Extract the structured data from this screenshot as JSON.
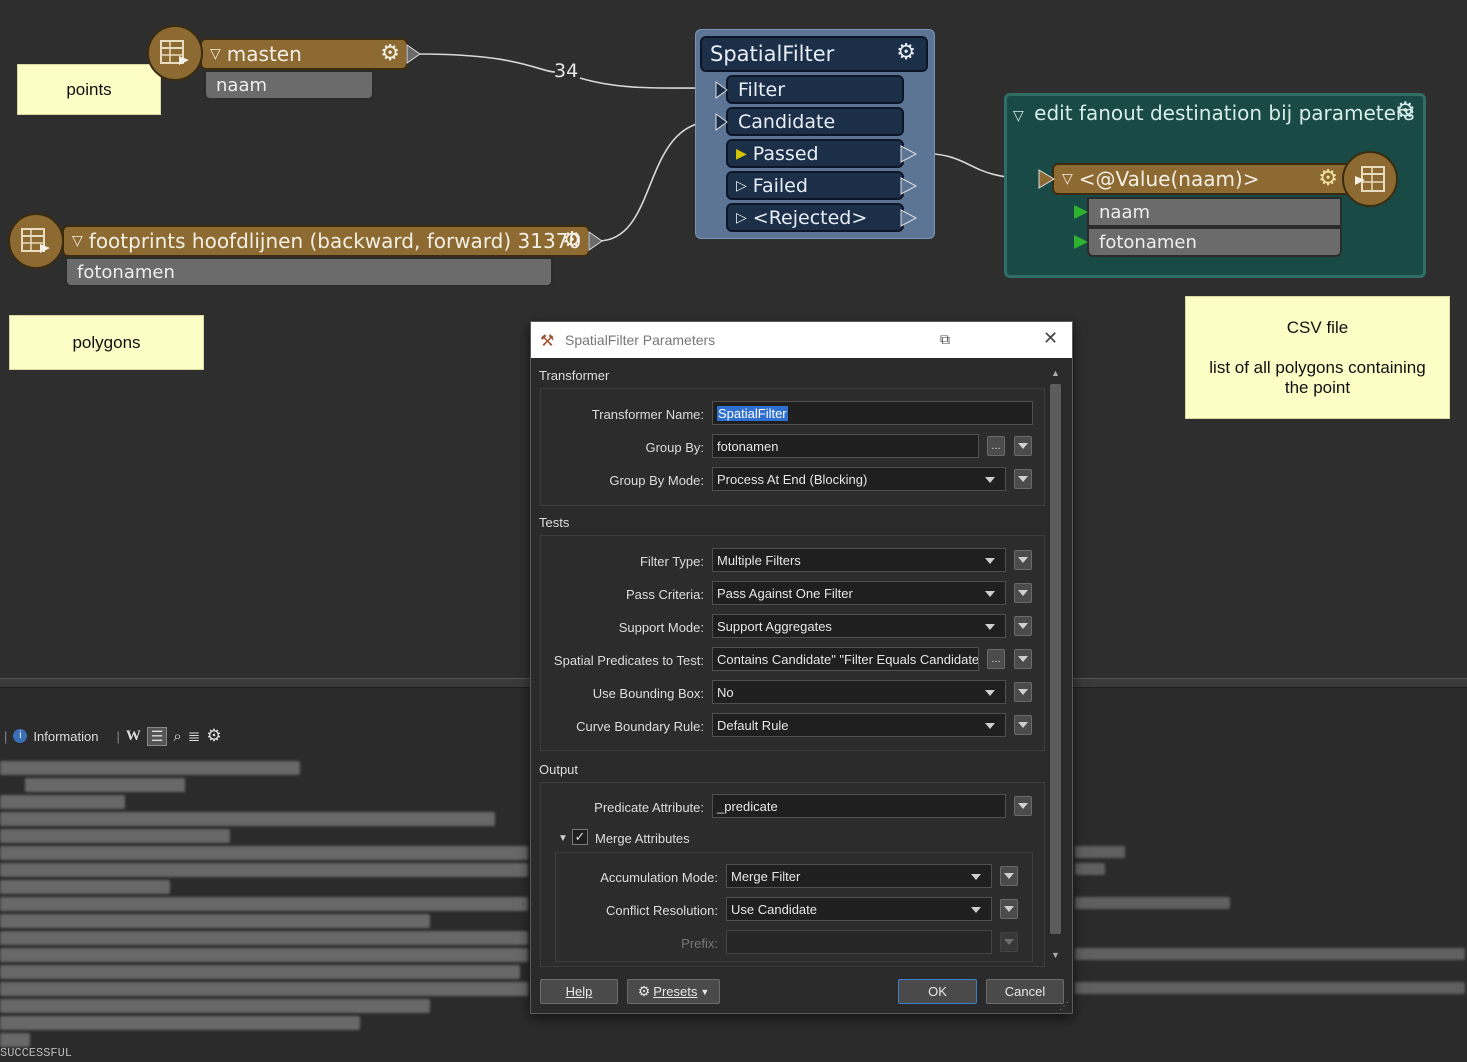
{
  "canvas": {
    "notes": {
      "points": "points",
      "polygons": "polygons",
      "csv_title": "CSV file",
      "csv_body": "list of all polygons containing the point"
    },
    "reader_masten": {
      "name": "masten",
      "attribute": "naam",
      "feature_count": "34"
    },
    "reader_footprints": {
      "name": "footprints hoofdlijnen (backward, forward) 31370",
      "attribute": "fotonamen"
    },
    "spatial_filter": {
      "name": "SpatialFilter",
      "inputs": [
        "Filter",
        "Candidate"
      ],
      "outputs": [
        "Passed",
        "Failed",
        "<Rejected>"
      ]
    },
    "bookmark": {
      "title": "edit fanout destination bij parameters",
      "writer": {
        "name": "<@Value(naam)>",
        "attributes": [
          "naam",
          "fotonamen"
        ]
      }
    }
  },
  "log": {
    "tab_label": "Information",
    "last_line": "SUCCESSFUL"
  },
  "dialog": {
    "title": "SpatialFilter Parameters",
    "groups": {
      "transformer": "Transformer",
      "tests": "Tests",
      "output": "Output"
    },
    "transformer_name_label": "Transformer Name:",
    "transformer_name_value": "SpatialFilter",
    "group_by_label": "Group By:",
    "group_by_value": "fotonamen",
    "group_by_mode_label": "Group By Mode:",
    "group_by_mode_value": "Process At End (Blocking)",
    "filter_type_label": "Filter Type:",
    "filter_type_value": "Multiple Filters",
    "pass_criteria_label": "Pass Criteria:",
    "pass_criteria_value": "Pass Against One Filter",
    "support_mode_label": "Support Mode:",
    "support_mode_value": "Support Aggregates",
    "spatial_predicates_label": "Spatial Predicates to Test:",
    "spatial_predicates_value": "Contains Candidate\" \"Filter Equals Candidate\"",
    "bounding_box_label": "Use Bounding Box:",
    "bounding_box_value": "No",
    "curve_boundary_label": "Curve Boundary Rule:",
    "curve_boundary_value": "Default Rule",
    "predicate_attr_label": "Predicate Attribute:",
    "predicate_attr_value": "_predicate",
    "merge_attributes_label": "Merge Attributes",
    "accumulation_mode_label": "Accumulation Mode:",
    "accumulation_mode_value": "Merge Filter",
    "conflict_resolution_label": "Conflict Resolution:",
    "conflict_resolution_value": "Use Candidate",
    "prefix_label": "Prefix:",
    "prefix_value": "",
    "ellipsis": "...",
    "buttons": {
      "help": "Help",
      "presets": "Presets",
      "ok": "OK",
      "cancel": "Cancel"
    }
  },
  "colors": {
    "reader_brown": "#8c6a32",
    "filter_blue": "#5d7594",
    "bookmark_teal": "#1a4a45",
    "note_yellow": "#fdfdc6",
    "passed_port": "#d4c400",
    "green_port": "#2fb02f"
  }
}
